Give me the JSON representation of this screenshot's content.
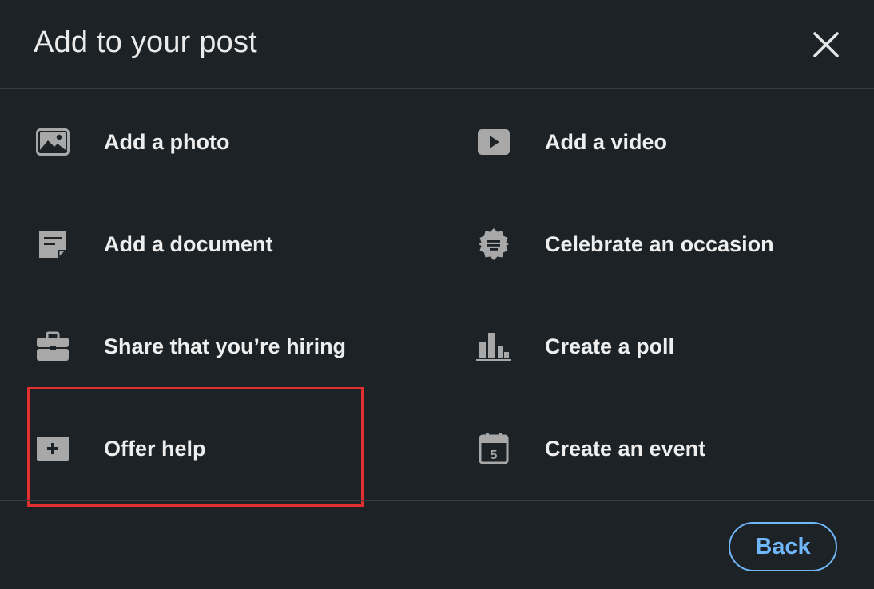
{
  "header": {
    "title": "Add to your post",
    "close_icon": "close-icon"
  },
  "options": {
    "photo": {
      "label": "Add a photo",
      "icon": "photo-icon"
    },
    "video": {
      "label": "Add a video",
      "icon": "video-icon"
    },
    "document": {
      "label": "Add a document",
      "icon": "document-icon"
    },
    "occasion": {
      "label": "Celebrate an occasion",
      "icon": "celebrate-badge-icon"
    },
    "hiring": {
      "label": "Share that you’re hiring",
      "icon": "briefcase-icon"
    },
    "poll": {
      "label": "Create a poll",
      "icon": "bar-chart-icon"
    },
    "help": {
      "label": "Offer help",
      "icon": "plus-box-icon"
    },
    "event": {
      "label": "Create an event",
      "icon": "calendar-icon",
      "calendar_day": "5"
    }
  },
  "footer": {
    "back_label": "Back"
  },
  "colors": {
    "background": "#1d2226",
    "divider": "#3a3f43",
    "icon": "#a8a8a8",
    "text": "#eeeeee",
    "accent": "#71b7fb",
    "highlight": "#e3302f"
  }
}
